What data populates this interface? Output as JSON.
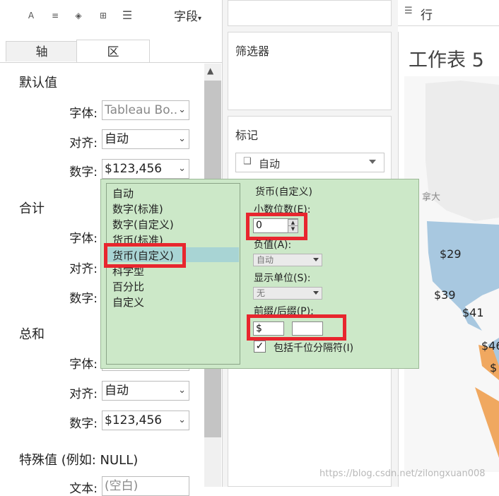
{
  "toolbar": {
    "icons": [
      "font-icon",
      "align-icon",
      "shading-icon",
      "borders-icon",
      "lines-icon"
    ],
    "fields_label": "字段"
  },
  "tabs": [
    {
      "label": "轴"
    },
    {
      "label": "区"
    }
  ],
  "default_section": {
    "title": "默认值",
    "font_label": "字体:",
    "font_value": "Tableau Bo..",
    "align_label": "对齐:",
    "align_value": "自动",
    "number_label": "数字:",
    "number_value": "$123,456"
  },
  "total_section": {
    "title": "合计",
    "font_label": "字体:",
    "align_label": "对齐:",
    "number_label": "数字:"
  },
  "sum_section": {
    "title": "总和",
    "font_label": "字体:",
    "align_label": "对齐:",
    "align_value": "自动",
    "number_label": "数字:",
    "number_value": "$123,456"
  },
  "special_section": {
    "title": "特殊值 (例如: NULL)",
    "text_label": "文本:",
    "text_value": "(空白)"
  },
  "middle": {
    "filters_title": "筛选器",
    "marks_title": "标记",
    "marks_type": "自动"
  },
  "right": {
    "rows_label": "行",
    "sheet_title": "工作表 5",
    "map_labels": [
      "拿大",
      "$29",
      "$39",
      "$41",
      "$46",
      "$"
    ]
  },
  "popup": {
    "format_list": [
      "自动",
      "数字(标准)",
      "数字(自定义)",
      "货币(标准)",
      "货币(自定义)",
      "科学型",
      "百分比",
      "自定义"
    ],
    "selected_index": 4,
    "header": "货币(自定义)",
    "decimals_label": "小数位数(E):",
    "decimals_value": "0",
    "negative_label": "负值(A):",
    "negative_value": "自动",
    "units_label": "显示单位(S):",
    "units_value": "无",
    "prefix_suffix_label": "前缀/后缀(P):",
    "prefix_value": "$",
    "suffix_value": "",
    "thousands_label": "包括千位分隔符(I)",
    "thousands_checked": true
  },
  "watermark": "https://blog.csdn.net/zilongxuan008",
  "colors": {
    "popup_bg": "#cce8c8",
    "selection": "#a8d4d4",
    "highlight": "#e8262e",
    "map_blue": "#a8c8e0",
    "map_orange": "#f0a860"
  }
}
